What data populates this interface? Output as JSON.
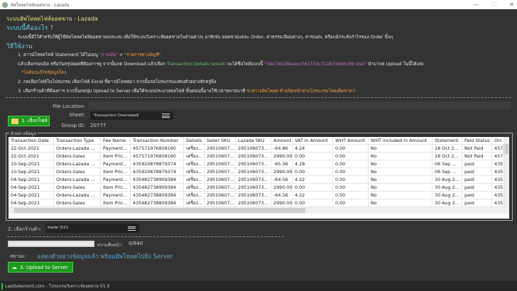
{
  "window": {
    "title": "อัพโหลดไฟล์ยอดขาย - Lazada",
    "controls": [
      "—",
      "☐",
      "✕"
    ]
  },
  "intro": {
    "heading": "ระบบอัพโหลดไฟล์ยอดขาย - Lazada",
    "what_title": "ระบบนี้คืออะไร ?",
    "what_desc": "ระบบนี้มีไว้สำหรับให้ผู้ใช้อัพโหลดไฟล์ยอดขายลงระบบ เพื่อให้ระบบวิเคราะห์ยอดขายในส่วนต่างๆ อาทิเช่น ยอดขายแต่ละ Order, ค่าธรรมเนียมต่างๆ, ค่าขนส่ง, หรือแม้กระทั่งกำไรของ Order นั้นๆ",
    "howto_title": "วิธีใช้งาน",
    "step1_a": "1. ดาวน์โหลดไฟล์ Statement ได้ในเมนู ",
    "step1_menu1": "\"การเงิน\"",
    "step1_gt": " > ",
    "step1_menu2": "\"รายการทางบัญชี\"",
    "step1b_a": "แล้วเลือกรอบบิล หรือวันสรุปยอดที่ต้องการดู จากนั้นกด Download แล้วเลือก ",
    "step1b_green": "Transaction Details (excel)",
    "step1b_b": " จะได้ชื่อไฟล์แบบนี้ ",
    "step1b_file": "\"34e74b28baeccf41733c71a87ddebc99.xlsx\"",
    "step1b_c": " นำมากด Upload ในนี้ได้เลย",
    "step1_note": "*ไม่ต้องแก้ไขข้อมูลใดๆ",
    "step2": "2. กดเลือกไฟล์ในโปรแกรม เลือกไฟล์ Excel ที่ดาวน์โหลดมา จากนั้นรอโปรแกรมแสดงตัวอย่างสักครู่นึง",
    "step3_a": "3. เลือกร้านค้าที่ต้องการ จากนั้นกดปุ่ม Upload to Server เพื่อให้ระบบประมวลผลไฟล์ ขั้นตอนนี้อาจใช้เวลาหลายนาที ",
    "step3_warn": "ระหว่างอัพโหลด ห้ามปิดหน้าต่างโปรแกรมโดยเด็ดขาด!!"
  },
  "file": {
    "select_button": "1. เลือกไฟล์",
    "location_label": "File Location:",
    "location_value": "",
    "sheet_label": "Sheet:",
    "sheet_value": "'Transaction Overview$'",
    "group_label": "Group ID:",
    "group_value": "20777"
  },
  "preview": {
    "label": "ตัวอย่างข้อมูล",
    "columns": [
      "Transaction Date",
      "Transaction Type",
      "Fee Name",
      "Transaction Number",
      "Details",
      "Seller SKU",
      "Lazada SKU",
      "Amount",
      "VAT in Amount",
      "WHT Amount",
      "WHT included in Amount",
      "Statement",
      "Paid Status",
      "Orc"
    ],
    "rows": [
      [
        "22-Oct-2021",
        "Orders-Lazada ...",
        "Payment...",
        "457571976858160",
        "เครื่อง...",
        "29510607...",
        "295106073...",
        "-64.86",
        "4.24",
        "0.00",
        "No",
        "18 Oct 2...",
        "Not Paid",
        "457"
      ],
      [
        "22-Oct-2021",
        "Orders-Sales",
        "Item Pric...",
        "457571976858160",
        "เครื่อง...",
        "29510607...",
        "295106073...",
        "2990.00",
        "0.00",
        "0.00",
        "No",
        "18 Oct 2...",
        "Not Paid",
        "457"
      ],
      [
        "10-Sep-2021",
        "Orders-Lazada ...",
        "Payment...",
        "435920878879374",
        "เครื่อง...",
        "29510607...",
        "295106073...",
        "-65.36",
        "4.28",
        "0.00",
        "No",
        "06 Sep ...",
        "paid",
        "435"
      ],
      [
        "10-Sep-2021",
        "Orders-Sales",
        "Item Pric...",
        "435920878879374",
        "เครื่อง...",
        "29510607...",
        "295106073...",
        "2990.00",
        "0.00",
        "0.00",
        "No",
        "06 Sep ...",
        "paid",
        "435"
      ],
      [
        "04-Sep-2021",
        "Orders-Lazada ...",
        "Payment...",
        "435482738909384",
        "เครื่อง...",
        "29510607...",
        "295106073...",
        "-64.56",
        "4.22",
        "0.00",
        "No",
        "30 Aug 2...",
        "paid",
        "435"
      ],
      [
        "04-Sep-2021",
        "Orders-Sales",
        "Item Pric...",
        "435482738909384",
        "เครื่อง...",
        "29510607...",
        "295106073...",
        "2990.00",
        "0.00",
        "0.00",
        "No",
        "30 Aug 2...",
        "paid",
        "435"
      ],
      [
        "04-Sep-2021",
        "Orders-Lazada ...",
        "Payment...",
        "435482738809384",
        "เครื่อง...",
        "29510607...",
        "295106073...",
        "-64.56",
        "4.22",
        "0.00",
        "No",
        "30 Aug 2...",
        "paid",
        "435"
      ],
      [
        "04-Sep-2021",
        "Orders-Sales",
        "Item Pric...",
        "435482738809384",
        "เครื่อง...",
        "29510607...",
        "295106073...",
        "2990.00",
        "0.00",
        "0.00",
        "No",
        "30 Aug 2...",
        "paid",
        "435"
      ]
    ]
  },
  "shop": {
    "label": "2. เลือกร้านค้า:",
    "value": "Kaide |521"
  },
  "progress": {
    "label": "ความคืบหน้า:",
    "value": "0/840",
    "fraction": 0
  },
  "status": {
    "label": "สถานะ:",
    "text": "แสดงตัวอย่างข้อมูลแล้ว พร้อมอัพโหลดไปยัง Server"
  },
  "upload": {
    "button": "3. Upload to Server"
  },
  "footer": {
    "text": "Lazstatement.com - โปรแกรมวิเคราะห์ยอดขาย V1.0"
  },
  "colors": {
    "background": "#333333",
    "button_green": "#1b9a1b",
    "heading_yellow": "#e8e07a",
    "heading_cyan": "#6cc9e8",
    "status_blue": "#5aa9d6",
    "warning_orange": "#f0a040"
  }
}
